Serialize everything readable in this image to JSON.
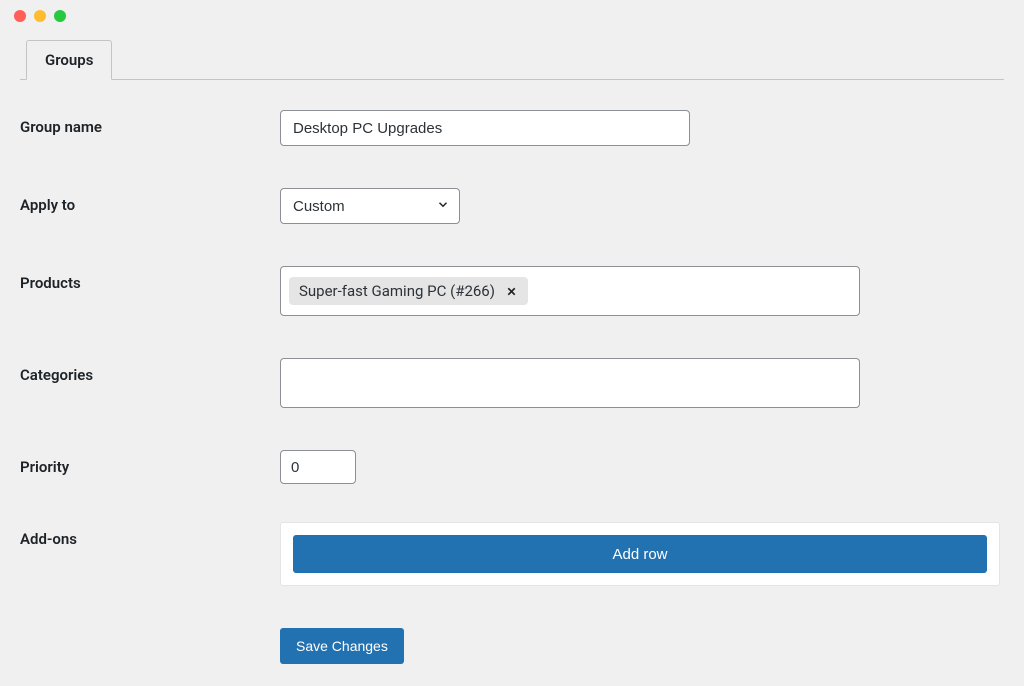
{
  "tabs": {
    "active": "Groups"
  },
  "form": {
    "group_name": {
      "label": "Group name",
      "value": "Desktop PC Upgrades"
    },
    "apply_to": {
      "label": "Apply to",
      "value": "Custom"
    },
    "products": {
      "label": "Products",
      "tags": [
        {
          "text": "Super-fast Gaming PC (#266)"
        }
      ]
    },
    "categories": {
      "label": "Categories"
    },
    "priority": {
      "label": "Priority",
      "value": "0"
    },
    "addons": {
      "label": "Add-ons",
      "add_row_label": "Add row"
    }
  },
  "actions": {
    "save_label": "Save Changes"
  }
}
